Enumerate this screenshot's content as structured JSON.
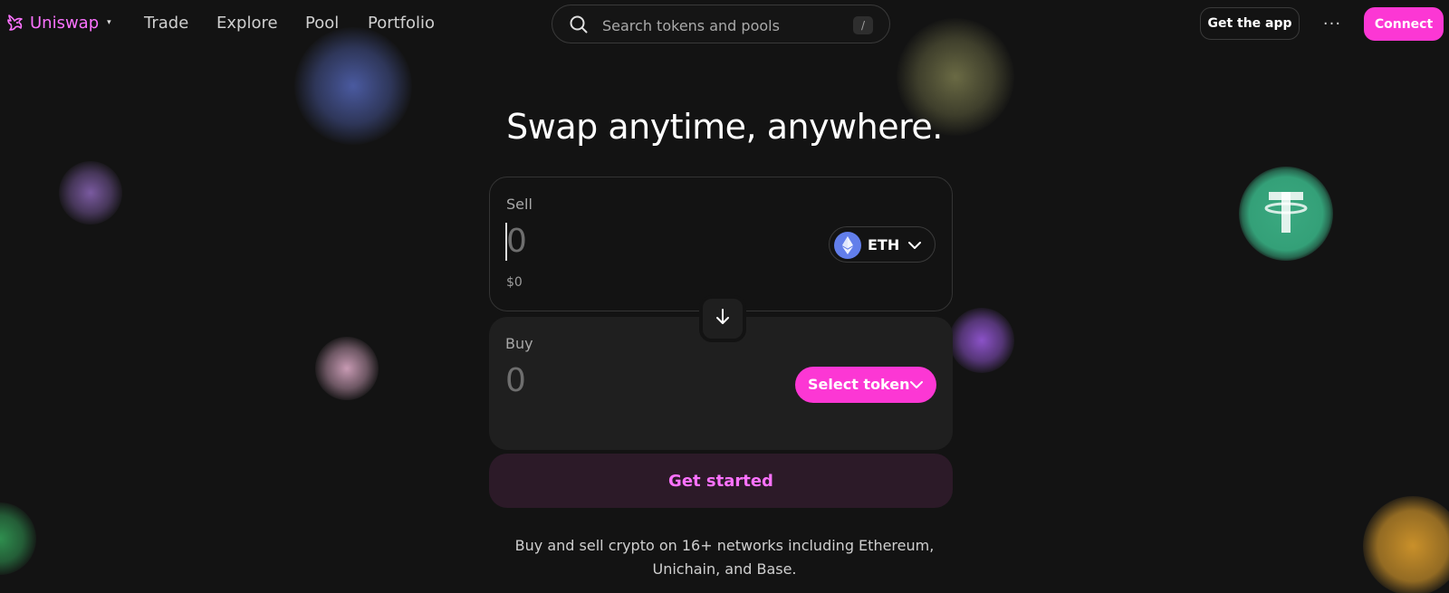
{
  "nav": {
    "brand": "Uniswap",
    "brand_caret": "▾",
    "links": [
      "Trade",
      "Explore",
      "Pool",
      "Portfolio"
    ],
    "search_placeholder": "Search tokens and pools",
    "search_shortcut": "/",
    "get_app_label": "Get the app",
    "more_label": "···",
    "connect_label": "Connect"
  },
  "hero": {
    "headline": "Swap anytime, anywhere."
  },
  "swap": {
    "sell": {
      "label": "Sell",
      "amount": "0",
      "usd_value": "$0",
      "token_symbol": "ETH"
    },
    "buy": {
      "label": "Buy",
      "amount": "0",
      "select_token_label": "Select token"
    },
    "cta_label": "Get started"
  },
  "footer": {
    "tagline_line1": "Buy and sell crypto on 16+ networks including Ethereum,",
    "tagline_line2": "Unichain, and Base."
  },
  "colors": {
    "accent_pink": "#FC37D4",
    "brand_pink": "#FC72FF",
    "background": "#131313",
    "eth_blue": "#627EEA"
  },
  "icons": {
    "logo": "uniswap-unicorn-icon",
    "search": "search-icon",
    "swap": "arrow-down-icon",
    "token_dropdown": "chevron-down-icon",
    "eth": "ethereum-icon",
    "more": "more-horizontal-icon"
  }
}
